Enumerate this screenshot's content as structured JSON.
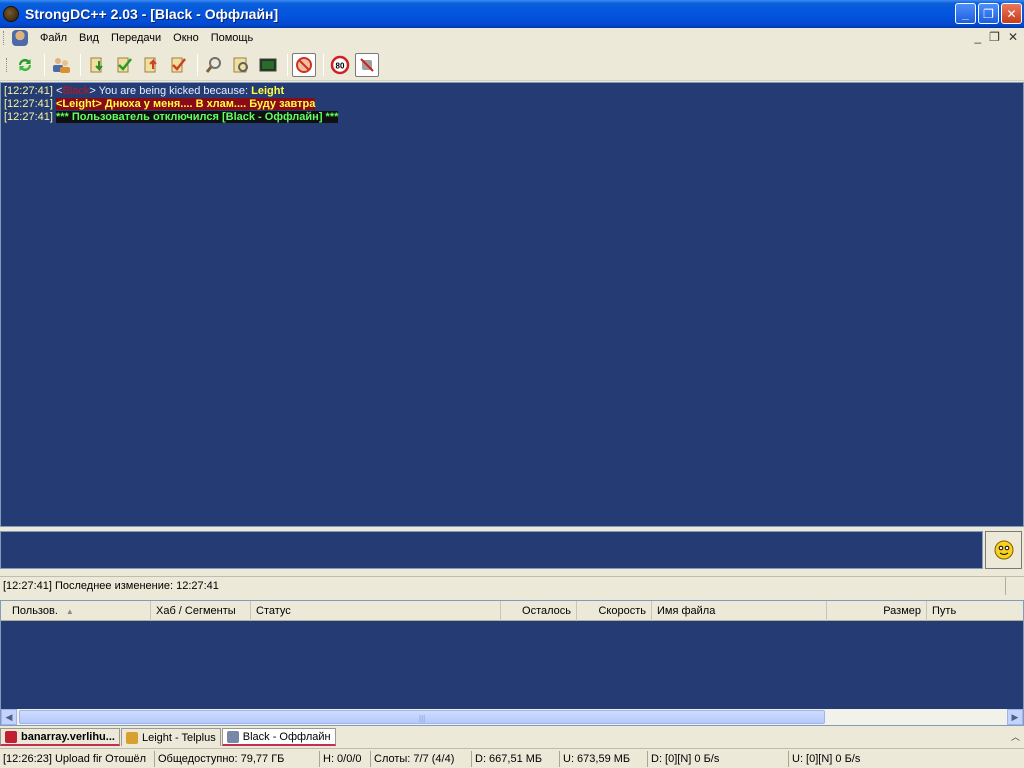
{
  "window": {
    "title": "StrongDC++ 2.03 - [Black - Оффлайн]",
    "minimize": "_",
    "maximize": "❐",
    "close": "✕"
  },
  "menu": {
    "items": [
      "Файл",
      "Вид",
      "Передачи",
      "Окно",
      "Помощь"
    ],
    "mdi_min": "_",
    "mdi_restore": "❐",
    "mdi_close": "✕"
  },
  "toolbar": {
    "icons": [
      "reconnect-icon",
      "users-icon",
      "download-queue-icon",
      "finished-downloads-icon",
      "upload-queue-icon",
      "finished-uploads-icon",
      "search-icon",
      "adl-search-icon",
      "notepad-icon",
      "away-icon",
      "limiter-icon",
      "disconnect-icon"
    ],
    "limiter_label": "80"
  },
  "chat": {
    "lines": [
      {
        "time": "[12:27:41]",
        "open": "<",
        "nick": "Black",
        "close": ">",
        "text": "You are being kicked because:",
        "reason": "Leight"
      },
      {
        "time": "[12:27:41]",
        "message": "<Leight> Днюха у меня.... В хлам.... Буду завтра"
      },
      {
        "time": "[12:27:41]",
        "message": "*** Пользователь отключился [Black - Оффлайн] ***"
      }
    ]
  },
  "chat_status": "[12:27:41] Последнее изменение: 12:27:41",
  "transfers": {
    "columns": [
      "Пользов.",
      "Хаб / Сегменты",
      "Статус",
      "Осталось",
      "Скорость",
      "Имя файла",
      "Размер",
      "Путь"
    ],
    "sort_indicator": "▲",
    "scroll_left": "◀",
    "scroll_right": "▶",
    "scroll_grip": "|||"
  },
  "tabs": [
    {
      "label": "banarray.verlihu...",
      "color": "#c02030"
    },
    {
      "label": "Leight - Telplus",
      "color": "#d8a030"
    },
    {
      "label": "Black - Оффлайн",
      "color": "#7a88a8"
    }
  ],
  "tab_chevron": "︿",
  "statusbar": {
    "log": "[12:26:23] Upload fir Отошёл",
    "shared": "Общедоступно: 79,77 ГБ",
    "hubs": "H: 0/0/0",
    "slots": "Слоты: 7/7 (4/4)",
    "downloaded": "D: 667,51 МБ",
    "uploaded": "U: 673,59 МБ",
    "down_speed": "D: [0][N] 0 Б/s",
    "up_speed": "U: [0][N] 0 Б/s"
  }
}
